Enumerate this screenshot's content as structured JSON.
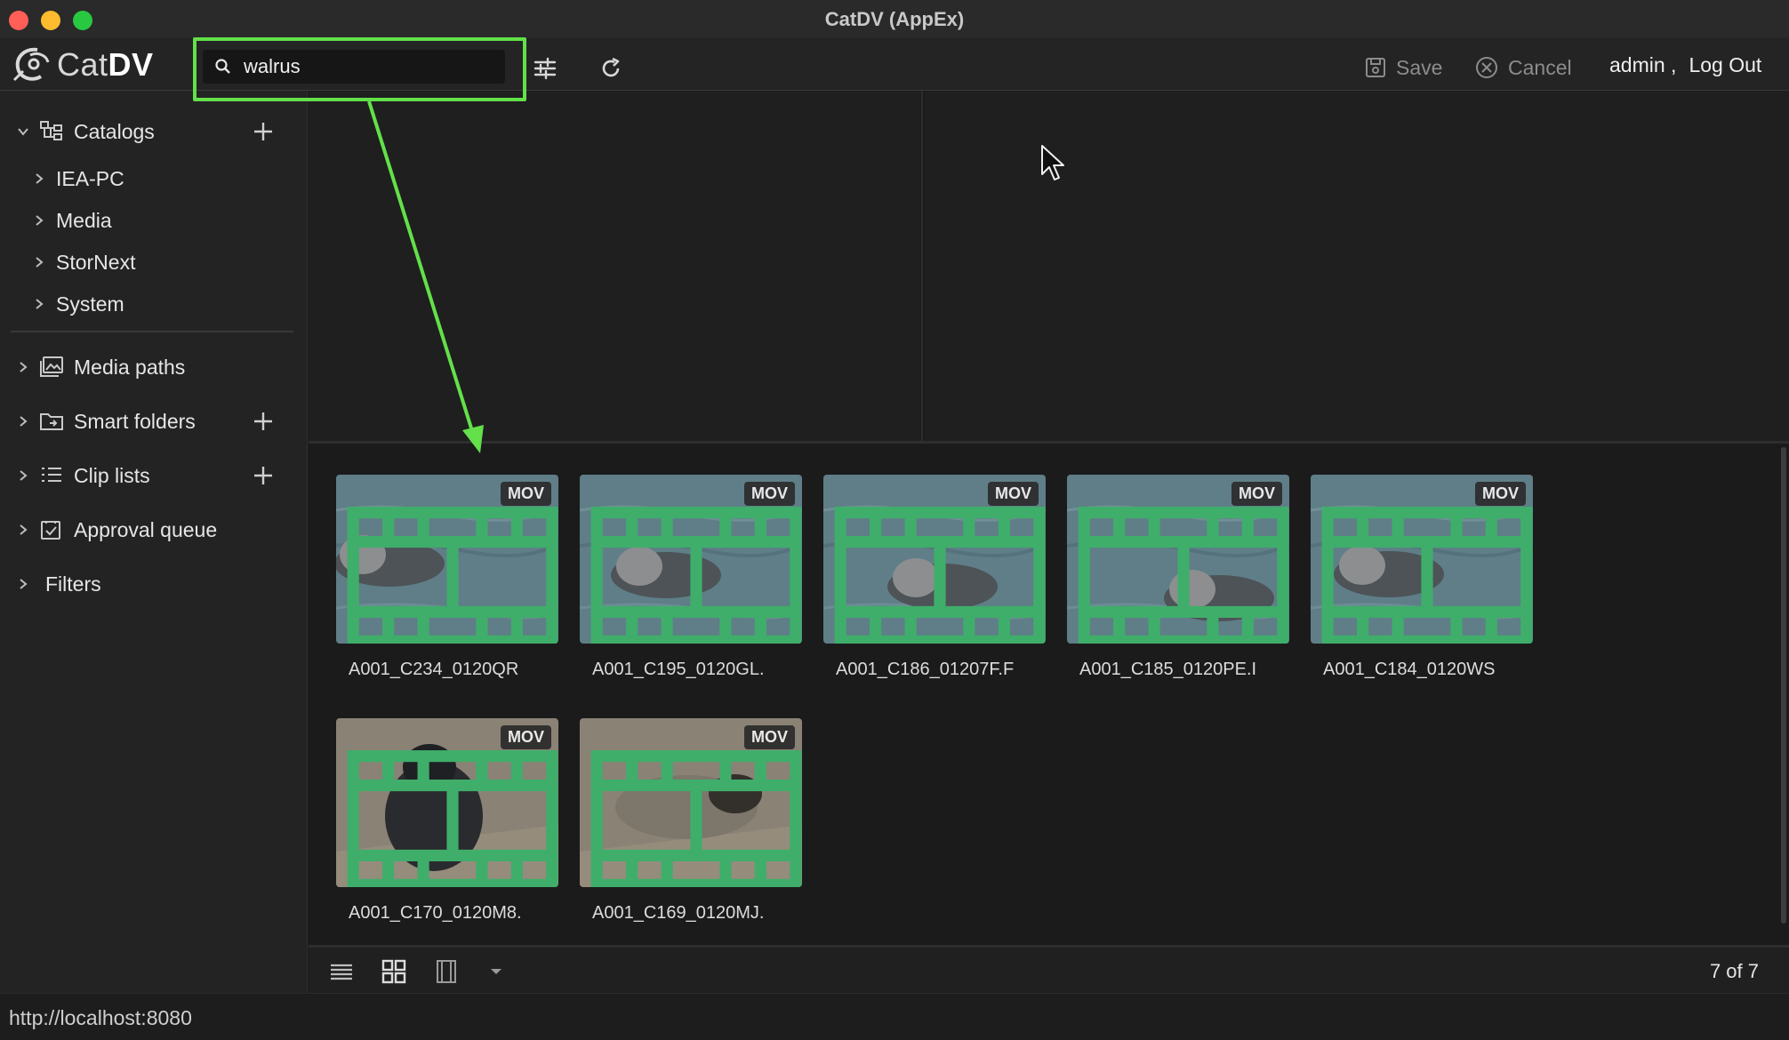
{
  "window": {
    "title": "CatDV (AppEx)"
  },
  "toolbar": {
    "logo_text_light": "Cat",
    "logo_text_bold": "DV",
    "search_value": "walrus",
    "save_label": "Save",
    "cancel_label": "Cancel",
    "username": "admin ,",
    "logout_label": "Log Out"
  },
  "sidebar": {
    "catalogs_label": "Catalogs",
    "catalog_items": [
      "IEA-PC",
      "Media",
      "StorNext",
      "System"
    ],
    "media_paths_label": "Media paths",
    "smart_folders_label": "Smart folders",
    "clip_lists_label": "Clip lists",
    "approval_queue_label": "Approval queue",
    "filters_label": "Filters"
  },
  "clips": [
    {
      "name": "A001_C234_0120QR",
      "format": "MOV",
      "scene": "water"
    },
    {
      "name": "A001_C195_0120GL.",
      "format": "MOV",
      "scene": "water"
    },
    {
      "name": "A001_C186_01207F.F",
      "format": "MOV",
      "scene": "water"
    },
    {
      "name": "A001_C185_0120PE.I",
      "format": "MOV",
      "scene": "water"
    },
    {
      "name": "A001_C184_0120WS",
      "format": "MOV",
      "scene": "water"
    },
    {
      "name": "A001_C170_0120M8.",
      "format": "MOV",
      "scene": "sand"
    },
    {
      "name": "A001_C169_0120MJ.",
      "format": "MOV",
      "scene": "sand"
    }
  ],
  "footer": {
    "count": "7 of 7"
  },
  "status": {
    "url": "http://localhost:8080"
  },
  "colors": {
    "highlight": "#63e04a",
    "film_icon": "#3fae6a",
    "water": "#5f7e88",
    "sand": "#8a8275"
  }
}
